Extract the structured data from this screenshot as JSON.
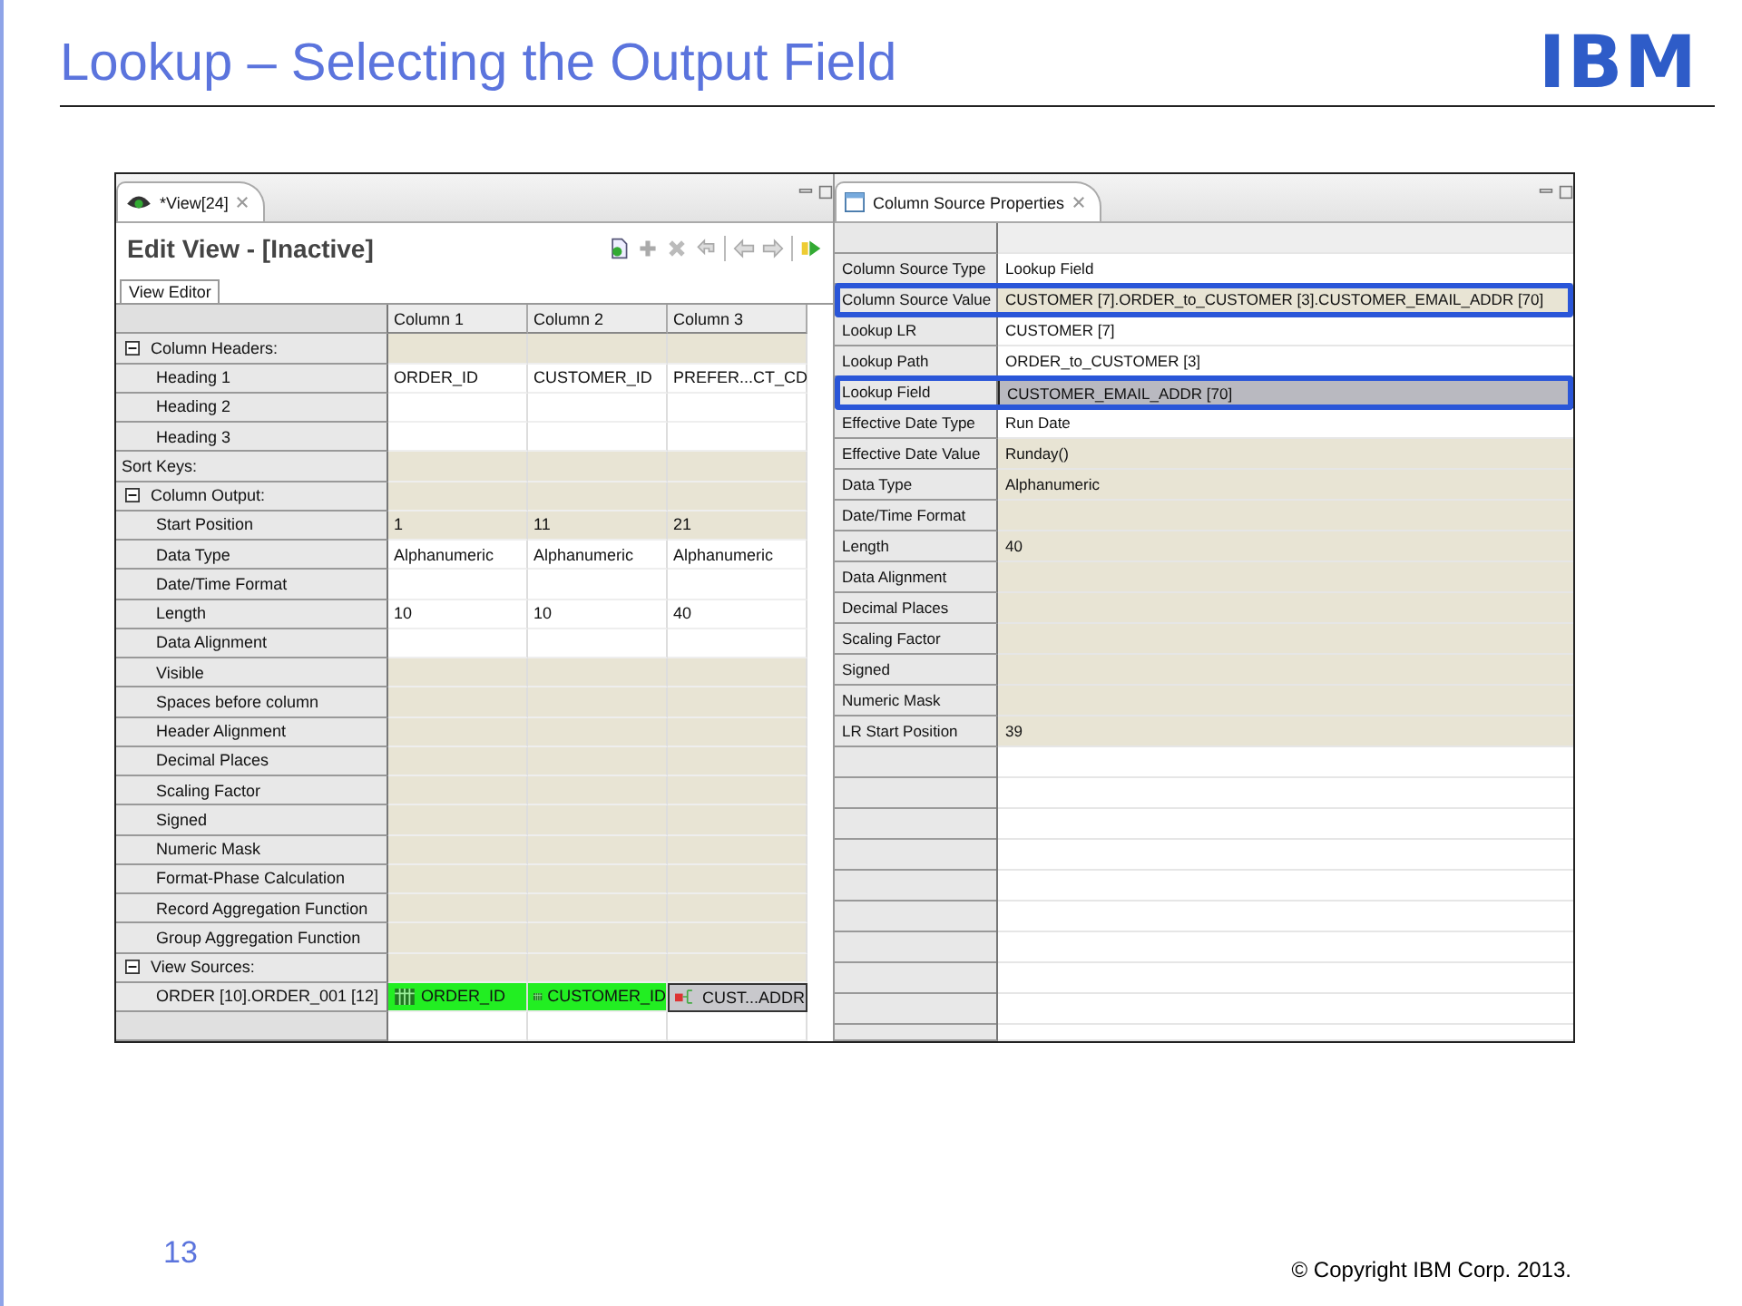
{
  "slide": {
    "title": "Lookup – Selecting the Output Field",
    "logo": "IBM",
    "page_number": "13",
    "copyright": "© Copyright  IBM Corp. 2013."
  },
  "editor": {
    "tab": "*View[24]",
    "heading": "Edit View - [Inactive]",
    "subtab": "View Editor",
    "columns": [
      "Column 1",
      "Column 2",
      "Column 3"
    ],
    "rows": [
      {
        "kind": "group",
        "label": "Column Headers:",
        "expanded": true,
        "shaded": true
      },
      {
        "kind": "field",
        "label": "Heading 1",
        "shaded": false,
        "cells": [
          "ORDER_ID",
          "CUSTOMER_ID",
          "PREFER...CT_CD"
        ]
      },
      {
        "kind": "field",
        "label": "Heading 2",
        "shaded": false
      },
      {
        "kind": "field",
        "label": "Heading 3",
        "shaded": false
      },
      {
        "kind": "section",
        "label": "Sort Keys:",
        "shaded": true
      },
      {
        "kind": "group",
        "label": "Column Output:",
        "expanded": true,
        "shaded": true
      },
      {
        "kind": "field",
        "label": "Start Position",
        "shaded": true,
        "cells": [
          "1",
          "11",
          "21"
        ]
      },
      {
        "kind": "field",
        "label": "Data Type",
        "shaded": false,
        "cells": [
          "Alphanumeric",
          "Alphanumeric",
          "Alphanumeric"
        ]
      },
      {
        "kind": "field",
        "label": "Date/Time Format",
        "shaded": false
      },
      {
        "kind": "field",
        "label": "Length",
        "shaded": false,
        "cells": [
          "10",
          "10",
          "40"
        ]
      },
      {
        "kind": "field",
        "label": "Data Alignment",
        "shaded": false
      },
      {
        "kind": "field",
        "label": "Visible",
        "shaded": true
      },
      {
        "kind": "field",
        "label": "Spaces before column",
        "shaded": true
      },
      {
        "kind": "field",
        "label": "Header Alignment",
        "shaded": true
      },
      {
        "kind": "field",
        "label": "Decimal Places",
        "shaded": true
      },
      {
        "kind": "field",
        "label": "Scaling Factor",
        "shaded": true
      },
      {
        "kind": "field",
        "label": "Signed",
        "shaded": true
      },
      {
        "kind": "field",
        "label": "Numeric Mask",
        "shaded": true
      },
      {
        "kind": "field",
        "label": "Format-Phase Calculation",
        "shaded": true
      },
      {
        "kind": "field",
        "label": "Record Aggregation Function",
        "shaded": true
      },
      {
        "kind": "field",
        "label": "Group Aggregation Function",
        "shaded": true
      },
      {
        "kind": "group",
        "label": "View Sources:",
        "expanded": true,
        "shaded": true
      },
      {
        "kind": "source",
        "label": "ORDER [10].ORDER_001 [12]",
        "sources": [
          {
            "kind": "field",
            "text": "ORDER_ID",
            "selected": false
          },
          {
            "kind": "field",
            "text": "CUSTOMER_ID",
            "selected": false
          },
          {
            "kind": "lookup",
            "text": "CUST...ADDR",
            "selected": true
          }
        ]
      }
    ]
  },
  "properties": {
    "tab": "Column Source Properties",
    "rows": [
      {
        "label": "Column Source Type",
        "value": "Lookup Field",
        "shaded": false,
        "highlighted": false,
        "selected": false
      },
      {
        "label": "Column Source Value",
        "value": "CUSTOMER [7].ORDER_to_CUSTOMER [3].CUSTOMER_EMAIL_ADDR [70]",
        "shaded": true,
        "highlighted": true,
        "selected": false
      },
      {
        "label": "Lookup LR",
        "value": "CUSTOMER [7]",
        "shaded": false,
        "highlighted": false,
        "selected": false
      },
      {
        "label": "Lookup Path",
        "value": "ORDER_to_CUSTOMER [3]",
        "shaded": false,
        "highlighted": false,
        "selected": false
      },
      {
        "label": "Lookup Field",
        "value": "CUSTOMER_EMAIL_ADDR [70]",
        "shaded": false,
        "highlighted": true,
        "selected": true
      },
      {
        "label": "Effective Date Type",
        "value": "Run Date",
        "shaded": false,
        "highlighted": false,
        "selected": false
      },
      {
        "label": "Effective Date Value",
        "value": "Runday()",
        "shaded": true,
        "highlighted": false,
        "selected": false
      },
      {
        "label": "Data Type",
        "value": "Alphanumeric",
        "shaded": true,
        "highlighted": false,
        "selected": false
      },
      {
        "label": "Date/Time Format",
        "shaded": true,
        "highlighted": false,
        "selected": false
      },
      {
        "label": "Length",
        "value": "40",
        "shaded": true,
        "highlighted": false,
        "selected": false
      },
      {
        "label": "Data Alignment",
        "shaded": true,
        "highlighted": false,
        "selected": false
      },
      {
        "label": "Decimal Places",
        "shaded": true,
        "highlighted": false,
        "selected": false
      },
      {
        "label": "Scaling Factor",
        "shaded": true,
        "highlighted": false,
        "selected": false
      },
      {
        "label": "Signed",
        "shaded": true,
        "highlighted": false,
        "selected": false
      },
      {
        "label": "Numeric Mask",
        "shaded": true,
        "highlighted": false,
        "selected": false
      },
      {
        "label": "LR Start Position",
        "value": "39",
        "shaded": true,
        "highlighted": false,
        "selected": false
      }
    ]
  }
}
